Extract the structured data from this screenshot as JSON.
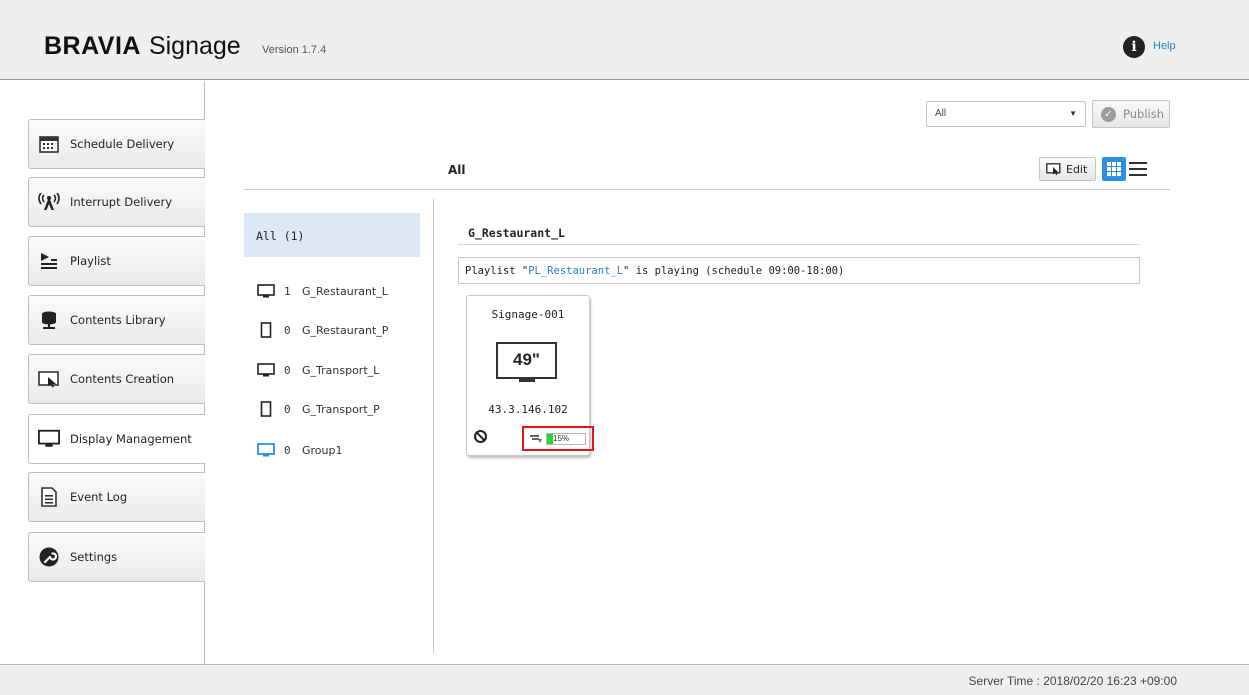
{
  "header": {
    "brand_bold": "BRAVIA",
    "brand_light": "Signage",
    "version": "Version 1.7.4",
    "help_label": "Help",
    "help_icon": "info-icon"
  },
  "sidebar": {
    "items": [
      {
        "label": "Schedule Delivery",
        "icon": "calendar-icon"
      },
      {
        "label": "Interrupt Delivery",
        "icon": "broadcast-icon"
      },
      {
        "label": "Playlist",
        "icon": "playlist-icon"
      },
      {
        "label": "Contents Library",
        "icon": "library-icon"
      },
      {
        "label": "Contents Creation",
        "icon": "edit-screen-icon"
      },
      {
        "label": "Display Management",
        "icon": "monitor-icon",
        "active": true
      },
      {
        "label": "Event Log",
        "icon": "document-icon"
      },
      {
        "label": "Settings",
        "icon": "wrench-icon"
      }
    ]
  },
  "toolbar": {
    "filter_value": "All",
    "publish_label": "Publish",
    "group_title": "All",
    "edit_label": "Edit"
  },
  "groups": {
    "all_label": "All (1)",
    "items": [
      {
        "count": "1",
        "name": "G_Restaurant_L",
        "icon": "landscape-monitor-icon"
      },
      {
        "count": "0",
        "name": "G_Restaurant_P",
        "icon": "portrait-monitor-icon"
      },
      {
        "count": "0",
        "name": "G_Transport_L",
        "icon": "landscape-monitor-icon"
      },
      {
        "count": "0",
        "name": "G_Transport_P",
        "icon": "portrait-monitor-icon"
      },
      {
        "count": "0",
        "name": "Group1",
        "icon": "monitor-blue-icon"
      }
    ]
  },
  "detail": {
    "title": "G_Restaurant_L",
    "status_prefix": "Playlist \"",
    "status_playlist": "PL_Restaurant_L",
    "status_suffix": "\" is playing (schedule 09:00-18:00)",
    "device": {
      "name": "Signage-001",
      "size": "49\"",
      "ip": "43.3.146.102",
      "progress_text": "15%",
      "progress": 0.15
    }
  },
  "footer": {
    "server_time": "Server Time : 2018/02/20 16:23 +09:00"
  },
  "colors": {
    "accent": "#2f8ee3",
    "link": "#2a7fd4",
    "highlight": "#e5131c",
    "progress": "#27d635"
  }
}
